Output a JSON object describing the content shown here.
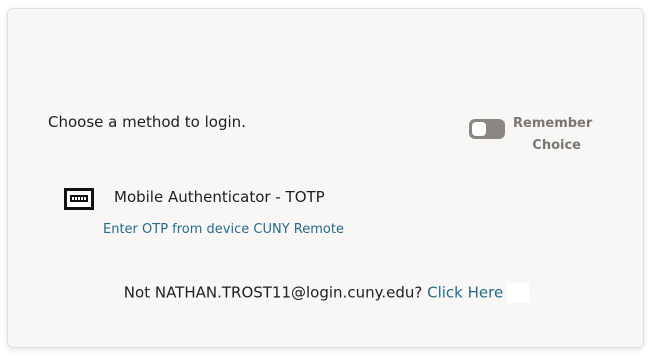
{
  "login": {
    "prompt": "Choose a method to login.",
    "remember": {
      "label_line1": "Remember",
      "label_line2": "Choice",
      "enabled": false
    },
    "methods": [
      {
        "title": "Mobile Authenticator - TOTP",
        "description": "Enter OTP from device CUNY Remote",
        "icon": "otp-device-icon"
      }
    ],
    "not_user": {
      "prefix": "Not NATHAN.TROST11@login.cuny.edu?",
      "link": "Click Here"
    }
  },
  "colors": {
    "link": "#246b8a",
    "toggle_off": "#8a8783",
    "card_bg": "#f8f7f6"
  }
}
